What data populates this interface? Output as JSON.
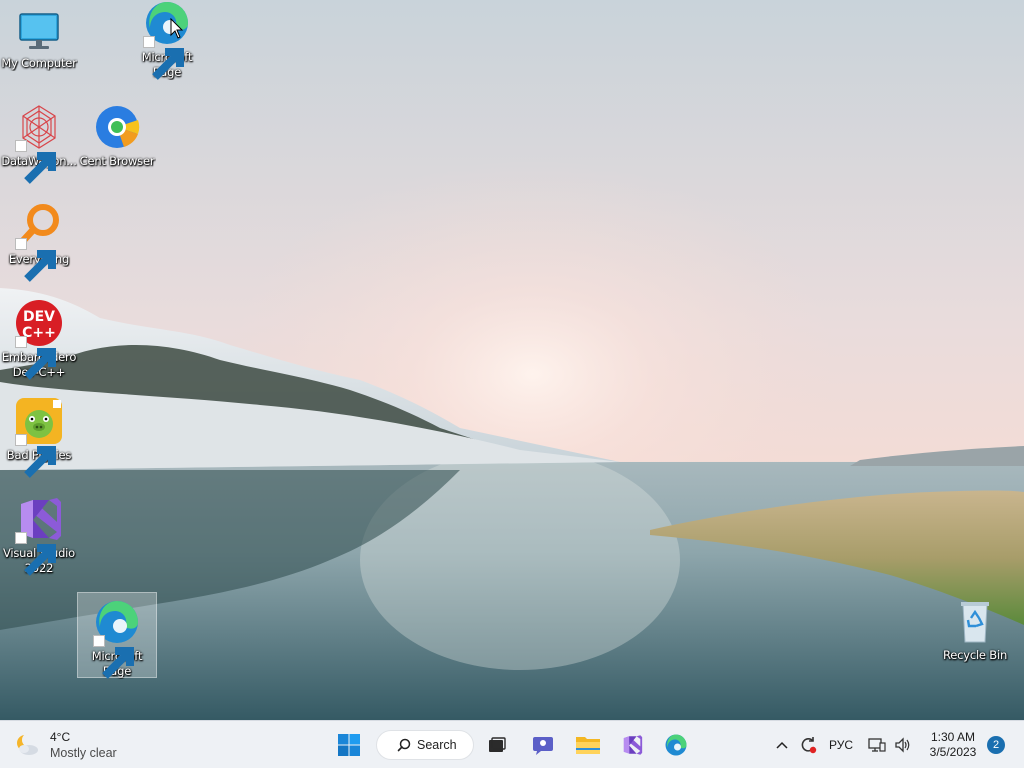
{
  "desktop": {
    "icons": [
      {
        "label": "My Computer",
        "icon": "monitor-icon"
      },
      {
        "label": "Microsoft\nEdge",
        "icon": "edge-icon"
      },
      {
        "label": "DataWagon...",
        "icon": "datawagon-icon"
      },
      {
        "label": "Cent Browser",
        "icon": "cent-browser-icon"
      },
      {
        "label": "Everything",
        "icon": "everything-search-icon"
      },
      {
        "label": "Embarcadero\nDev-C++",
        "icon": "devcpp-icon",
        "badge": "DEV C++"
      },
      {
        "label": "Bad Piggies",
        "icon": "bad-piggies-icon"
      },
      {
        "label": "Visual Studio\n2022",
        "icon": "visual-studio-icon"
      },
      {
        "label": "Microsoft\nEdge",
        "icon": "edge-icon",
        "selected": true
      },
      {
        "label": "Recycle Bin",
        "icon": "recycle-bin-icon"
      }
    ]
  },
  "taskbar": {
    "weather": {
      "temp": "4°C",
      "condition": "Mostly clear"
    },
    "search_label": "Search",
    "pinned": [
      "windows-start-icon",
      "task-view-icon",
      "chat-icon",
      "file-explorer-icon",
      "visual-studio-icon",
      "edge-icon"
    ],
    "tray": {
      "language": "РУС",
      "time": "1:30 AM",
      "date": "3/5/2023",
      "notifications": "2"
    }
  },
  "colors": {
    "taskbar_bg": "#eef1f5",
    "accent": "#1a6fb0"
  }
}
